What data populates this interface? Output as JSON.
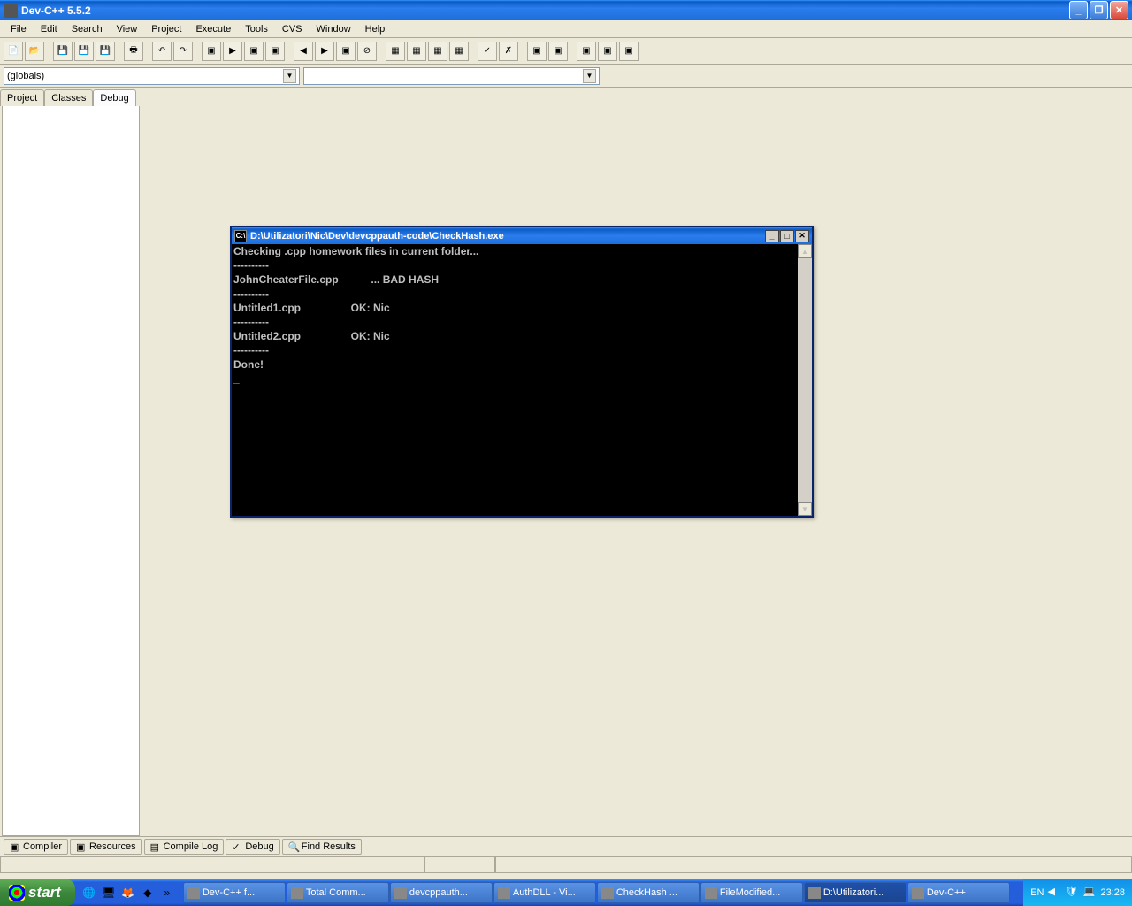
{
  "app": {
    "title": "Dev-C++ 5.5.2"
  },
  "menu": {
    "items": [
      "File",
      "Edit",
      "Search",
      "View",
      "Project",
      "Execute",
      "Tools",
      "CVS",
      "Window",
      "Help"
    ]
  },
  "combo": {
    "globals": "(globals)"
  },
  "side_tabs": {
    "project": "Project",
    "classes": "Classes",
    "debug": "Debug"
  },
  "console": {
    "title": "D:\\Utilizatori\\Nic\\Dev\\devcppauth-code\\CheckHash.exe",
    "output": "Checking .cpp homework files in current folder...\n----------\nJohnCheaterFile.cpp           ... BAD HASH\n----------\nUntitled1.cpp                 OK: Nic\n----------\nUntitled2.cpp                 OK: Nic\n----------\nDone!\n_"
  },
  "bottom_tabs": {
    "compiler": "Compiler",
    "resources": "Resources",
    "compile_log": "Compile Log",
    "debug": "Debug",
    "find_results": "Find Results"
  },
  "taskbar": {
    "start": "start",
    "items": [
      "Dev-C++ f...",
      "Total Comm...",
      "devcppauth...",
      "AuthDLL - Vi...",
      "CheckHash ...",
      "FileModified...",
      "D:\\Utilizatori...",
      "Dev-C++"
    ],
    "lang": "EN",
    "clock": "23:28"
  }
}
